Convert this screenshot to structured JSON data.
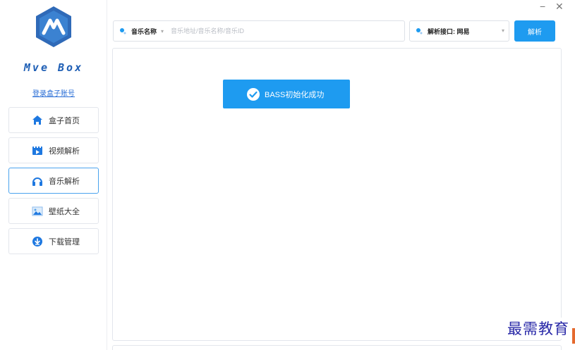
{
  "app": {
    "brand": "Mve Box",
    "login_link": "登录盒子账号"
  },
  "window": {
    "minimize": "−",
    "close": "✕"
  },
  "sidebar": {
    "items": [
      {
        "label": "盒子首页",
        "icon": "home-icon"
      },
      {
        "label": "视频解析",
        "icon": "video-icon"
      },
      {
        "label": "音乐解析",
        "icon": "headphones-icon",
        "active": true
      },
      {
        "label": "壁纸大全",
        "icon": "image-icon"
      },
      {
        "label": "下载管理",
        "icon": "download-icon"
      }
    ]
  },
  "search": {
    "type_label": "音乐名称",
    "placeholder": "音乐地址/音乐名称/音乐ID",
    "value": ""
  },
  "api": {
    "label": "解析接口: 网易"
  },
  "toolbar": {
    "parse_label": "解析"
  },
  "toast": {
    "message": "BASS初始化成功"
  },
  "watermark": {
    "text": "最需教育"
  },
  "colors": {
    "accent": "#1e9bf0",
    "brand": "#1f5fb5",
    "logo_bg": "#2f6ab8",
    "watermark": "#2a2aa8"
  }
}
